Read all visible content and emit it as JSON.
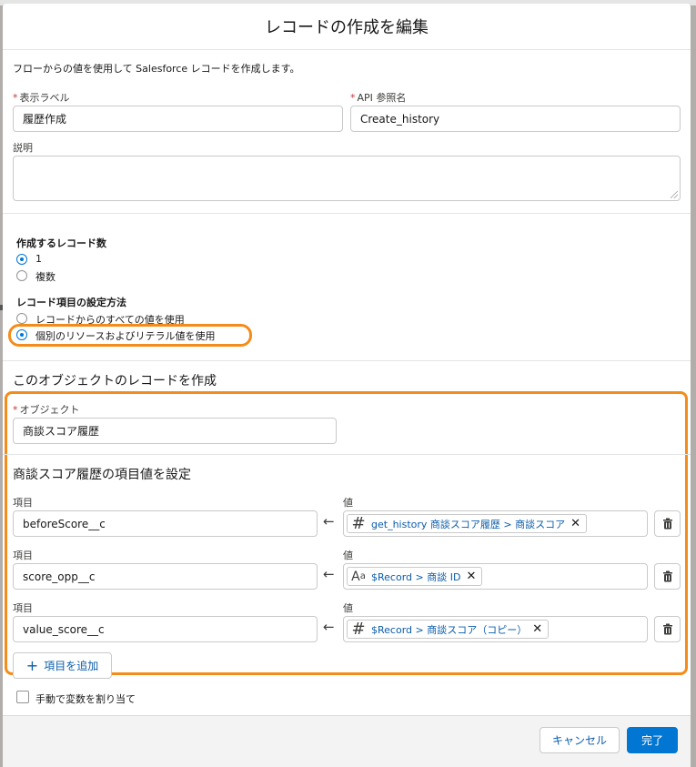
{
  "modal": {
    "title": "レコードの作成を編集",
    "description": "フローからの値を使用して Salesforce レコードを作成します。"
  },
  "fields": {
    "label_label": "表示ラベル",
    "label_value": "履歴作成",
    "api_label": "API 参照名",
    "api_value": "Create_history",
    "description_label": "説明",
    "description_value": ""
  },
  "record_count": {
    "heading": "作成するレコード数",
    "options": [
      "1",
      "複数"
    ],
    "selected": "1"
  },
  "set_method": {
    "heading": "レコード項目の設定方法",
    "options": [
      "レコードからのすべての値を使用",
      "個別のリソースおよびリテラル値を使用"
    ],
    "selected": "個別のリソースおよびリテラル値を使用"
  },
  "object_section": {
    "title": "このオブジェクトのレコードを作成",
    "object_label": "オブジェクト",
    "object_value": "商談スコア履歴"
  },
  "field_values": {
    "title": "商談スコア履歴の項目値を設定",
    "field_label": "項目",
    "value_label": "値",
    "rows": [
      {
        "field": "beforeScore__c",
        "icon": "number-icon",
        "value": "get_history 商談スコア履歴 > 商談スコア"
      },
      {
        "field": "score_opp__c",
        "icon": "text-icon",
        "value": "$Record > 商談 ID"
      },
      {
        "field": "value_score__c",
        "icon": "number-icon",
        "value": "$Record > 商談スコア（コピー）"
      }
    ],
    "add_label": "項目を追加"
  },
  "manual_assign": {
    "label": "手動で変数を割り当て",
    "checked": false
  },
  "footer": {
    "cancel_label": "キャンセル",
    "done_label": "完了"
  },
  "colors": {
    "brand": "#0176d3",
    "highlight": "#f48c1b",
    "link": "#0b5cab",
    "required": "#c23934"
  }
}
